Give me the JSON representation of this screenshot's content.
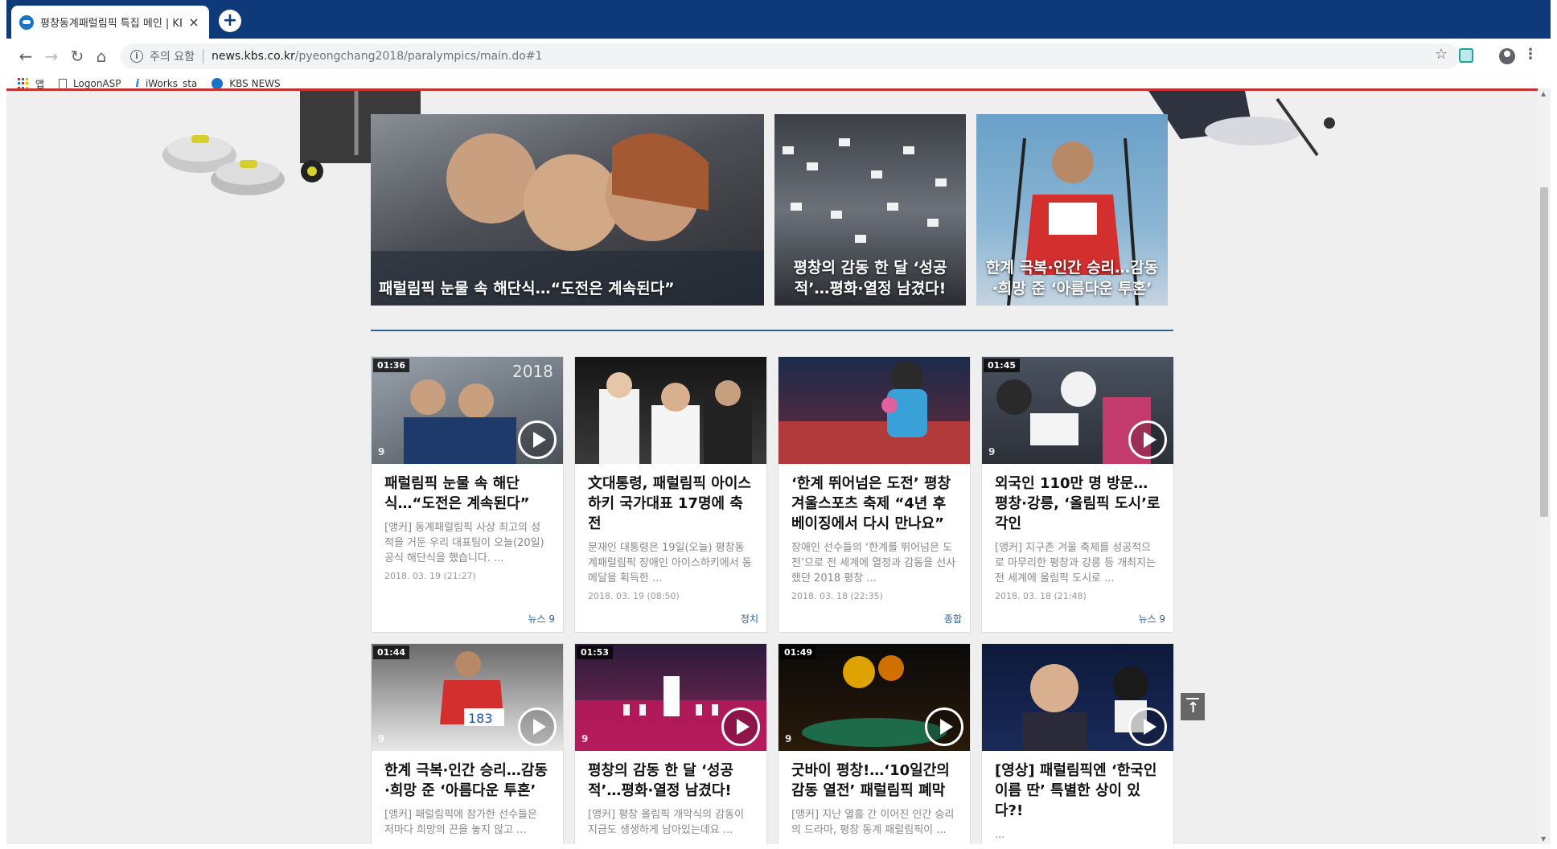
{
  "browser": {
    "tab_title": "평창동계패럴림픽 특집 메인 | KBS",
    "tab_close": "×",
    "newtab": "+",
    "warning": "주의 요함",
    "url_host": "news.kbs.co.kr",
    "url_path": "/pyeongchang2018/paralympics/main.do#1",
    "bookmarks": [
      "앱",
      "LogonASP",
      "iWorks_sta",
      "KBS NEWS"
    ]
  },
  "featured": [
    {
      "caption": "패럴림픽 눈물 속 해단식…“도전은 계속된다”"
    },
    {
      "caption": "평창의 감동 한 달 ‘성공적’…평화·열정 남겼다!"
    },
    {
      "caption": "한계 극복·인간 승리…감동·희망 준 ‘아름다운 투혼’"
    }
  ],
  "cards_row1": [
    {
      "duration": "01:36",
      "title": "패럴림픽 눈물 속 해단식…“도전은 계속된다”",
      "desc": "[앵커] 동계패럴림픽 사상 최고의 성적을 거둔 우리 대표팀이 오늘(20일) 공식 해단식을 했습니다. ...",
      "date": "2018. 03. 19 (21:27)",
      "category": "뉴스 9"
    },
    {
      "duration": "",
      "title": "文대통령, 패럴림픽 아이스하키 국가대표 17명에 축전",
      "desc": "문재인 대통령은 19일(오늘) 평창동계패럴림픽 장애인 아이스하키에서 동메달을 획득한 ...",
      "date": "2018. 03. 19 (08:50)",
      "category": "정치"
    },
    {
      "duration": "",
      "title": "‘한계 뛰어넘은 도전’ 평창 겨울스포츠 축제 “4년 후 베이징에서 다시 만나요”",
      "desc": "장애인 선수들의 ‘한계를 뛰어넘은 도전’으로 전 세계에 열정과 감동을 선사했던 2018 평창 ...",
      "date": "2018. 03. 18 (22:35)",
      "category": "종합"
    },
    {
      "duration": "01:45",
      "title": "외국인 110만 명 방문…평창·강릉, ‘올림픽 도시’로 각인",
      "desc": "[앵커] 지구촌 겨울 축제를 성공적으로 마무리한 평창과 강릉 등 개최지는 전 세계에 올림픽 도시로 ...",
      "date": "2018. 03. 18 (21:48)",
      "category": "뉴스 9"
    }
  ],
  "cards_row2": [
    {
      "duration": "01:44",
      "title": "한계 극복·인간 승리…감동·희망 준 ‘아름다운 투혼’",
      "desc": "[앵커] 패럴림픽에 참가한 선수들은 저마다 희망의 끈을 놓지 않고 ..."
    },
    {
      "duration": "01:53",
      "title": "평창의 감동 한 달 ‘성공적’…평화·열정 남겼다!",
      "desc": "[앵커] 평창 올림픽 개막식의 감동이 지금도 생생하게 남아있는데요 ..."
    },
    {
      "duration": "01:49",
      "title": "굿바이 평창!…‘10일간의 감동 열전’ 패럴림픽 폐막",
      "desc": "[앵커] 지난 열흘 간 이어진 인간 승리의 드라마, 평창 동계 패럴림픽이 ..."
    },
    {
      "duration": "",
      "title": "[영상] 패럴림픽엔 ‘한국인 이름 딴’ 특별한 상이 있다?!",
      "desc": "..."
    }
  ],
  "badge_nine": "9"
}
